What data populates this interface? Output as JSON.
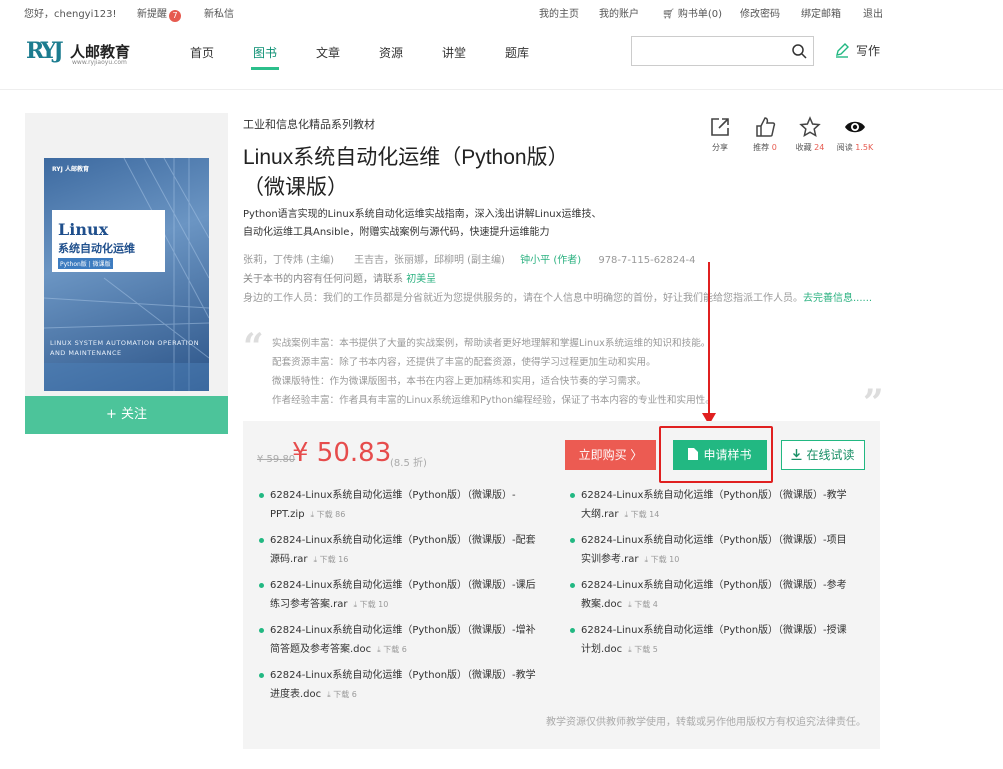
{
  "topbar": {
    "greeting": "您好，chengyi123!",
    "new_reminders": "新提醒",
    "reminder_count": "7",
    "new_messages": "新私信",
    "my_home": "我的主页",
    "my_account": "我的账户",
    "cart": "购书单(0)",
    "change_password": "修改密码",
    "bind_email": "绑定邮箱",
    "logout": "退出"
  },
  "header": {
    "logo_mark": "RYJ",
    "logo_name": "人邮教育",
    "logo_url": "www.ryjiaoyu.com",
    "nav": [
      "首页",
      "图书",
      "文章",
      "资源",
      "讲堂",
      "题库"
    ],
    "active_nav": "图书",
    "search_placeholder": "",
    "write_label": "写作"
  },
  "book": {
    "cover_top": "RYJ 人邮教育",
    "cover_title_en": "Linux",
    "cover_title_cn": "系统自动化运维",
    "cover_tag": "Python版 | 微课版",
    "cover_subtitle_en": "LINUX SYSTEM AUTOMATION OPERATION AND MAINTENANCE",
    "follow_label": "+ 关注",
    "series": "工业和信息化精品系列教材",
    "title": "Linux系统自动化运维（Python版）（微课版）",
    "description": "Python语言实现的Linux系统自动化运维实战指南，深入浅出讲解Linux运维技、自动化运维工具Ansible，附赠实战案例与源代码，快速提升运维能力",
    "authors": "张莉，丁传炜 (主编)　　王吉吉，张丽娜，邱柳明 (副主编)",
    "author_highlight": "钟小平 (作者)",
    "isbn": "978-7-115-62824-4",
    "contact_prefix": "关于本书的内容有任何问题，请联系",
    "contact_name": "初美呈",
    "workers_text": "身边的工作人员：我们的工作员都是分省就近为您提供服务的，请在个人信息中明确您的首份，好让我们能给您指派工作人员。",
    "workers_link": "去完善信息......",
    "highlights": [
      "实战案例丰富：本书提供了大量的实战案例，帮助读者更好地理解和掌握Linux系统运维的知识和技能。",
      "配套资源丰富：除了书本内容，还提供了丰富的配套资源，使得学习过程更加生动和实用。",
      "微课版特性：作为微课版图书，本书在内容上更加精练和实用，适合快节奏的学习需求。",
      "作者经验丰富：作者具有丰富的Linux系统运维和Python编程经验，保证了书本内容的专业性和实用性。"
    ]
  },
  "actions": {
    "share": "分享",
    "recommend": "推荐",
    "recommend_count": "0",
    "favorite": "收藏",
    "favorite_count": "24",
    "read": "阅读",
    "read_count": "1.5K"
  },
  "purchase": {
    "old_price": "¥ 59.80",
    "price": "¥ 50.83",
    "discount": "(8.5 折)",
    "buy_label": "立即购买 〉",
    "apply_label": "申请样书",
    "trial_label": "在线试读",
    "notice": "教学资源仅供教师教学使用，转载或另作他用版权方有权追究法律责任。"
  },
  "resources_left": [
    {
      "name": "62824-Linux系统自动化运维（Python版）（微课版）-PPT.zip",
      "downloads": "下载 86"
    },
    {
      "name": "62824-Linux系统自动化运维（Python版）（微课版）-配套源码.rar",
      "downloads": "下载 16"
    },
    {
      "name": "62824-Linux系统自动化运维（Python版）（微课版）-课后练习参考答案.rar",
      "downloads": "下载 10"
    },
    {
      "name": "62824-Linux系统自动化运维（Python版）（微课版）-增补简答题及参考答案.doc",
      "downloads": "下载 6"
    },
    {
      "name": "62824-Linux系统自动化运维（Python版）（微课版）-教学进度表.doc",
      "downloads": "下载 6"
    }
  ],
  "resources_right": [
    {
      "name": "62824-Linux系统自动化运维（Python版）（微课版）-教学大纲.rar",
      "downloads": "下载 14"
    },
    {
      "name": "62824-Linux系统自动化运维（Python版）（微课版）-项目实训参考.rar",
      "downloads": "下载 10"
    },
    {
      "name": "62824-Linux系统自动化运维（Python版）（微课版）-参考教案.doc",
      "downloads": "下载 4"
    },
    {
      "name": "62824-Linux系统自动化运维（Python版）（微课版）-授课计划.doc",
      "downloads": "下载 5"
    }
  ]
}
